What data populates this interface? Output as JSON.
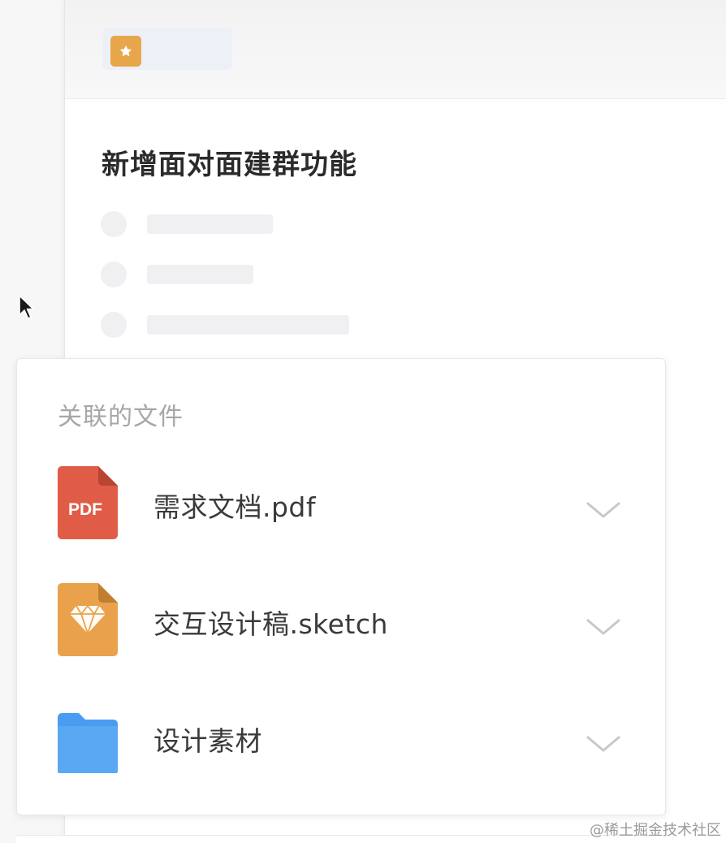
{
  "card": {
    "title": "新增面对面建群功能"
  },
  "popover": {
    "title": "关联的文件",
    "files": [
      {
        "name": "需求文档.pdf",
        "icon": "pdf-file-icon",
        "badge": "PDF",
        "color": "#e05c47"
      },
      {
        "name": "交互设计稿.sketch",
        "icon": "sketch-file-icon",
        "color": "#e9a24b"
      },
      {
        "name": "设计素材",
        "icon": "folder-icon",
        "color": "#4a9cf0"
      }
    ]
  },
  "watermark": "@稀土掘金技术社区",
  "colors": {
    "accent_star": "#e8a64b",
    "chevron": "#c8c8cc"
  }
}
